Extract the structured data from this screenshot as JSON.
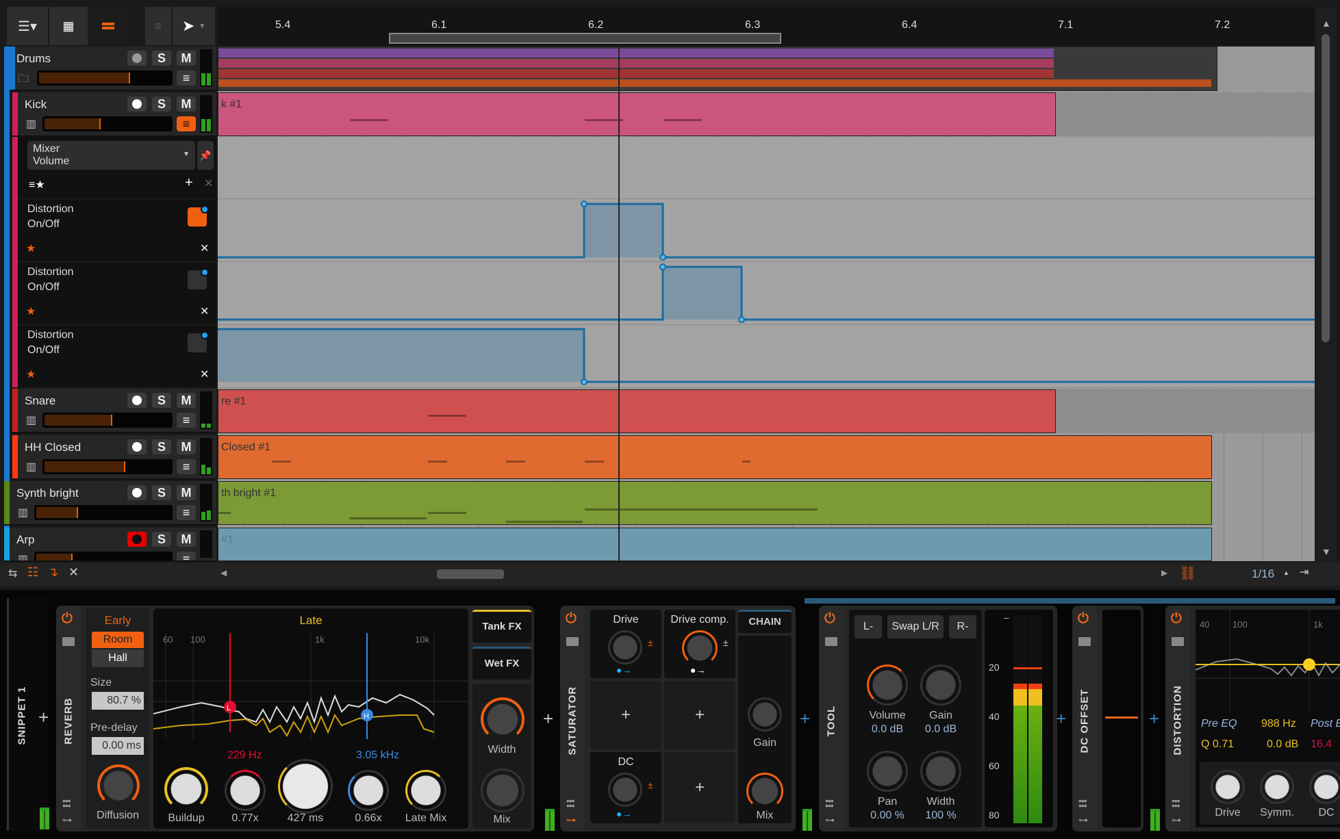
{
  "toolbar": {
    "icons": [
      "list-options-icon",
      "grid-view-icon",
      "arrange-view-icon",
      "track-list-icon",
      "pointer-tool-icon"
    ]
  },
  "ruler": {
    "labels": [
      "5.4",
      "6.1",
      "6.2",
      "6.3",
      "6.4",
      "7.1",
      "7.2"
    ]
  },
  "tracks": [
    {
      "name": "Drums",
      "color": "#7a4a9a",
      "strip": "#1a7ad0",
      "volume": 0.67,
      "type": "group"
    },
    {
      "name": "Kick",
      "color": "#cc5580",
      "strip": "#d0205a",
      "volume": 0.43
    },
    {
      "name": "Snare",
      "color": "#d05050",
      "strip": "#c82020",
      "volume": 0.52
    },
    {
      "name": "HH Closed",
      "color": "#e06a30",
      "strip": "#ff3c10",
      "volume": 0.62
    },
    {
      "name": "Synth bright",
      "color": "#7c9a35",
      "strip": "#5a8a18",
      "volume": 0.3
    },
    {
      "name": "Arp",
      "color": "#6e9ab0",
      "strip": "#1aa0e0",
      "volume": 0.26,
      "record_armed": true
    }
  ],
  "buttons": {
    "solo": "S",
    "mute": "M"
  },
  "clips": [
    {
      "label": "k #1"
    },
    {
      "label": "re #1"
    },
    {
      "label": "Closed #1"
    },
    {
      "label": "th bright #1"
    },
    {
      "label": "#1"
    }
  ],
  "automation": {
    "selector_line1": "Mixer",
    "selector_line2": "Volume",
    "lanes": [
      {
        "device": "Distortion",
        "param": "On/Off",
        "active": true
      },
      {
        "device": "Distortion",
        "param": "On/Off",
        "active": false
      },
      {
        "device": "Distortion",
        "param": "On/Off",
        "active": false
      }
    ]
  },
  "bottom_bar": {
    "grid": "1/16"
  },
  "devices": {
    "snippet": "SNIPPET 1",
    "reverb": {
      "title": "REVERB",
      "early": "Early",
      "room": "Room",
      "hall": "Hall",
      "size_label": "Size",
      "size": "80.7 %",
      "predelay_label": "Pre-delay",
      "predelay": "0.00 ms",
      "late": "Late",
      "freq_labels": [
        "60",
        "100",
        "1k",
        "10k"
      ],
      "low_freq": "229 Hz",
      "high_freq": "3.05 kHz",
      "knobs": [
        "Diffusion",
        "Buildup",
        "0.77x",
        "427 ms",
        "0.66x",
        "Late Mix"
      ],
      "tank_fx": "Tank FX",
      "wet_fx": "Wet FX",
      "width": "Width",
      "mix": "Mix"
    },
    "saturator": {
      "title": "SATURATOR",
      "drive": "Drive",
      "drive_comp": "Drive comp.",
      "chain": "CHAIN",
      "dc": "DC",
      "gain": "Gain",
      "mix": "Mix"
    },
    "tool": {
      "title": "TOOL",
      "l": "L-",
      "swap": "Swap L/R",
      "r": "R-",
      "volume": "Volume",
      "volume_val": "0.0 dB",
      "gain": "Gain",
      "gain_val": "0.0 dB",
      "pan": "Pan",
      "pan_val": "0.00 %",
      "width": "Width",
      "width_val": "100 %",
      "meter_scale": [
        "20",
        "40",
        "60",
        "80"
      ]
    },
    "dc_offset": {
      "title": "DC OFFSET"
    },
    "distortion": {
      "title": "DISTORTION",
      "freq_labels": [
        "40",
        "100",
        "1k"
      ],
      "pre_eq": "Pre EQ",
      "freq": "988 Hz",
      "post": "Post E",
      "q": "Q 0.71",
      "gain": "0.0 dB",
      "post_val": "16.4",
      "knobs": [
        "Drive",
        "Symm.",
        "DC"
      ]
    }
  }
}
